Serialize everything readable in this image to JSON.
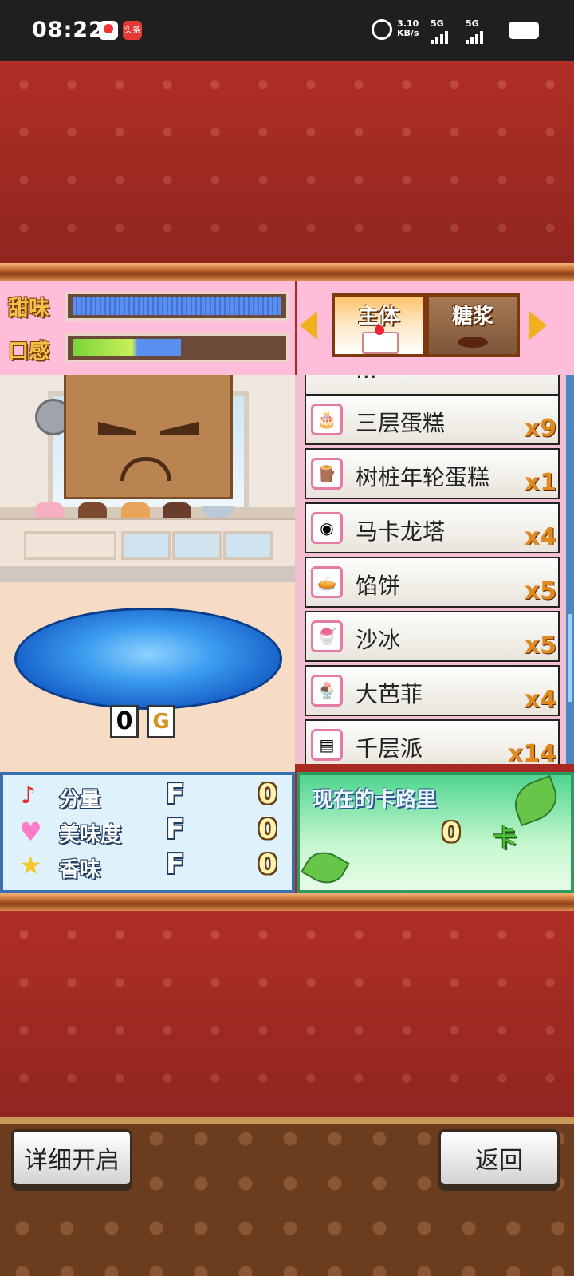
{
  "status_bar": {
    "time": "08:22",
    "badge_label": "头条",
    "net_speed": "3.10",
    "net_unit": "KB/s",
    "sim1": "5G",
    "sim2": "5G"
  },
  "gauges": {
    "sweetness_label": "甜味",
    "sweetness_level": 1.0,
    "texture_label": "口感",
    "texture_level": 0.52
  },
  "tabs": {
    "main_label": "主体",
    "topping_label": "糖浆",
    "active": "main"
  },
  "item_list": {
    "partial_top_name": "...",
    "items": [
      {
        "name": "三层蛋糕",
        "qty": "x9",
        "icon": "layer-cake-icon"
      },
      {
        "name": "树桩年轮蛋糕",
        "qty": "x1",
        "icon": "log-cake-icon"
      },
      {
        "name": "马卡龙塔",
        "qty": "x4",
        "icon": "macaron-icon"
      },
      {
        "name": "馅饼",
        "qty": "x5",
        "icon": "pie-icon"
      },
      {
        "name": "沙冰",
        "qty": "x5",
        "icon": "shaved-ice-icon"
      },
      {
        "name": "大芭菲",
        "qty": "x4",
        "icon": "parfait-icon"
      },
      {
        "name": "千层派",
        "qty": "x14",
        "icon": "mille-feuille-icon"
      }
    ]
  },
  "dish": {
    "price_value": "0",
    "price_unit": "G"
  },
  "stats": [
    {
      "label": "分量",
      "grade": "F",
      "value": "0",
      "icon": "music-note-icon"
    },
    {
      "label": "美味度",
      "grade": "F",
      "value": "0",
      "icon": "heart-icon"
    },
    {
      "label": "香味",
      "grade": "F",
      "value": "0",
      "icon": "star-icon"
    }
  ],
  "calorie": {
    "title": "现在的卡路里",
    "value": "0",
    "unit": "卡"
  },
  "buttons": {
    "detail_label": "详细开启",
    "back_label": "返回"
  },
  "colors": {
    "background_red": "#b02e26",
    "pink_panel": "#ffbdd9",
    "sweetness_bar": "#4f86e0",
    "texture_bar_green": "#9be04a",
    "stats_border": "#3a6fb0",
    "calorie_green": "#4fd58f"
  }
}
